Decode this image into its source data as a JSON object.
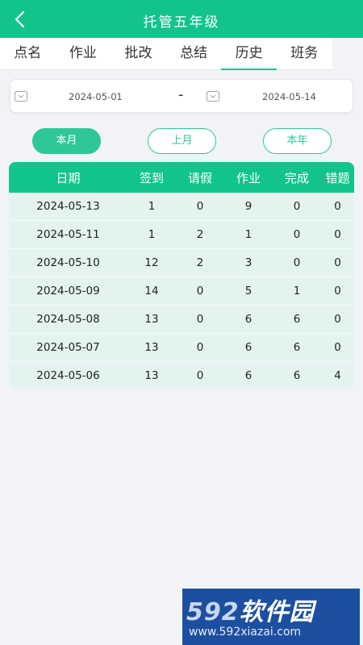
{
  "header": {
    "title": "托管五年级",
    "back_icon": "chevron-left-icon"
  },
  "tabs": [
    "点名",
    "作业",
    "批改",
    "总结",
    "历史",
    "班务"
  ],
  "active_tab": "历史",
  "date_range": {
    "start": "2024-05-01",
    "separator": "-",
    "end": "2024-05-14"
  },
  "quick_filters": [
    "本月",
    "上月",
    "本年"
  ],
  "table": {
    "headers": [
      "日期",
      "签到",
      "请假",
      "作业",
      "完成",
      "错题"
    ],
    "rows": [
      [
        "2024-05-13",
        "1",
        "0",
        "9",
        "0",
        "0"
      ],
      [
        "2024-05-11",
        "1",
        "2",
        "1",
        "0",
        "0"
      ],
      [
        "2024-05-10",
        "12",
        "2",
        "3",
        "0",
        "0"
      ],
      [
        "2024-05-09",
        "14",
        "0",
        "5",
        "1",
        "0"
      ],
      [
        "2024-05-08",
        "13",
        "0",
        "6",
        "6",
        "0"
      ],
      [
        "2024-05-07",
        "13",
        "0",
        "6",
        "6",
        "0"
      ],
      [
        "2024-05-06",
        "13",
        "0",
        "6",
        "6",
        "4"
      ]
    ]
  },
  "watermark": {
    "logo_num": "592",
    "logo_text": "软件园",
    "url": "www.592xiazai.com"
  },
  "colors": {
    "accent": "#12c48b",
    "table_bg": "#e3f3f0",
    "watermark_bg": "#1d4fa0"
  }
}
